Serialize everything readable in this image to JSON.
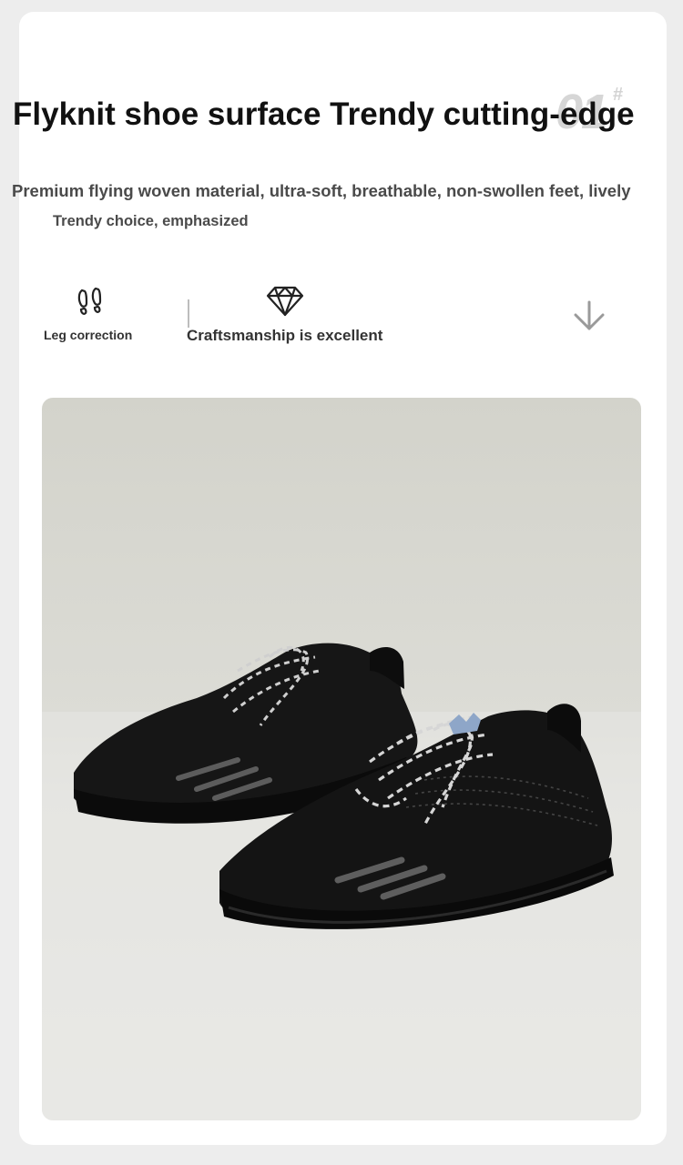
{
  "header": {
    "badge_number": "01",
    "badge_hash": "#",
    "title": "Flyknit shoe surface Trendy cutting-edge",
    "subtitle": "Premium flying woven material, ultra-soft, breathable, non-swollen feet, lively",
    "subtitle_line2": "Trendy choice, emphasized"
  },
  "features": [
    {
      "icon": "footprints-icon",
      "label": "Leg correction"
    },
    {
      "icon": "diamond-icon",
      "label": "Craftsmanship is excellent"
    }
  ],
  "scroll_hint": {
    "icon": "arrow-down-icon"
  },
  "product_photo": {
    "subject": "pair of black flyknit sneakers with reflective laces",
    "colors": {
      "background": "#dcdcd6",
      "shoe": "#141414",
      "accent_logo": "#8ea6c8"
    }
  }
}
